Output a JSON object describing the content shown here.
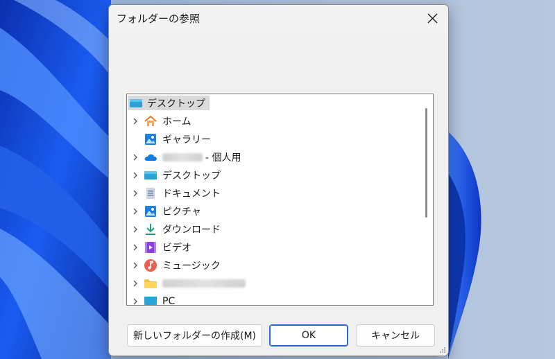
{
  "dialog": {
    "title": "フォルダーの参照",
    "close_icon": "close-icon"
  },
  "tree": {
    "root": {
      "label": "デスクトップ",
      "icon": "desktop-icon"
    },
    "items": [
      {
        "label": "ホーム",
        "icon": "home-icon",
        "expandable": true
      },
      {
        "label": "ギャラリー",
        "icon": "gallery-icon",
        "expandable": false
      },
      {
        "label": "- 個人用",
        "icon": "onedrive-icon",
        "expandable": true,
        "blurred_prefix": true
      },
      {
        "label": "デスクトップ",
        "icon": "desktop-icon",
        "expandable": true
      },
      {
        "label": "ドキュメント",
        "icon": "documents-icon",
        "expandable": true
      },
      {
        "label": "ピクチャ",
        "icon": "pictures-icon",
        "expandable": true
      },
      {
        "label": "ダウンロード",
        "icon": "download-icon",
        "expandable": true
      },
      {
        "label": "ビデオ",
        "icon": "video-icon",
        "expandable": true
      },
      {
        "label": "ミュージック",
        "icon": "music-icon",
        "expandable": true
      },
      {
        "label": "",
        "icon": "folder-icon",
        "expandable": true,
        "blurred_name": true
      },
      {
        "label": "PC",
        "icon": "pc-icon",
        "expandable": true
      }
    ]
  },
  "buttons": {
    "new_folder": "新しいフォルダーの作成(M)",
    "ok": "OK",
    "cancel": "キャンセル"
  },
  "colors": {
    "accent": "#2b6ad2",
    "wallpaper_blue": "#0a3fd8"
  }
}
